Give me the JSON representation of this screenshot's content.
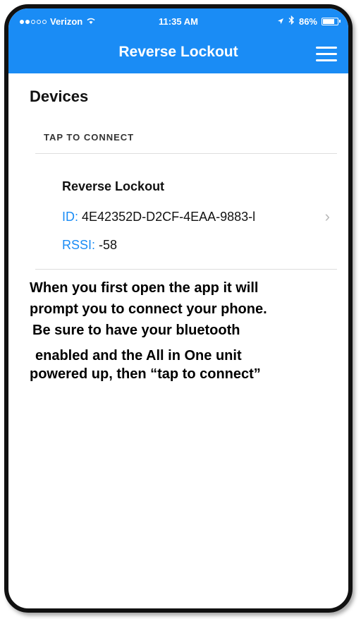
{
  "status_bar": {
    "carrier": "Verizon",
    "time": "11:35 AM",
    "battery": "86%",
    "battery_level": 0.86,
    "icons": [
      "signal-dots-icon",
      "wifi-icon",
      "location-arrow-icon",
      "bluetooth-icon",
      "battery-icon"
    ]
  },
  "nav": {
    "title": "Reverse Lockout",
    "menu_icon": "hamburger-menu-icon"
  },
  "page": {
    "heading": "Devices",
    "section_header": "TAP TO CONNECT"
  },
  "device": {
    "name": "Reverse Lockout",
    "id_label": "ID:",
    "id_value": "4E42352D-D2CF-4EAA-9883-l",
    "rssi_label": "RSSI:",
    "rssi_value": "-58",
    "chevron": "chevron-right-icon"
  },
  "instructions": {
    "line1": "When you first open the app it will",
    "line2": "prompt you to connect your phone.",
    "line3": "Be sure to have your bluetooth",
    "line4": "enabled and the All in One unit",
    "line5": "powered up, then “tap to connect”"
  },
  "colors": {
    "accent": "#1a8cf5",
    "background": "#ffffff",
    "divider": "#dedede"
  }
}
